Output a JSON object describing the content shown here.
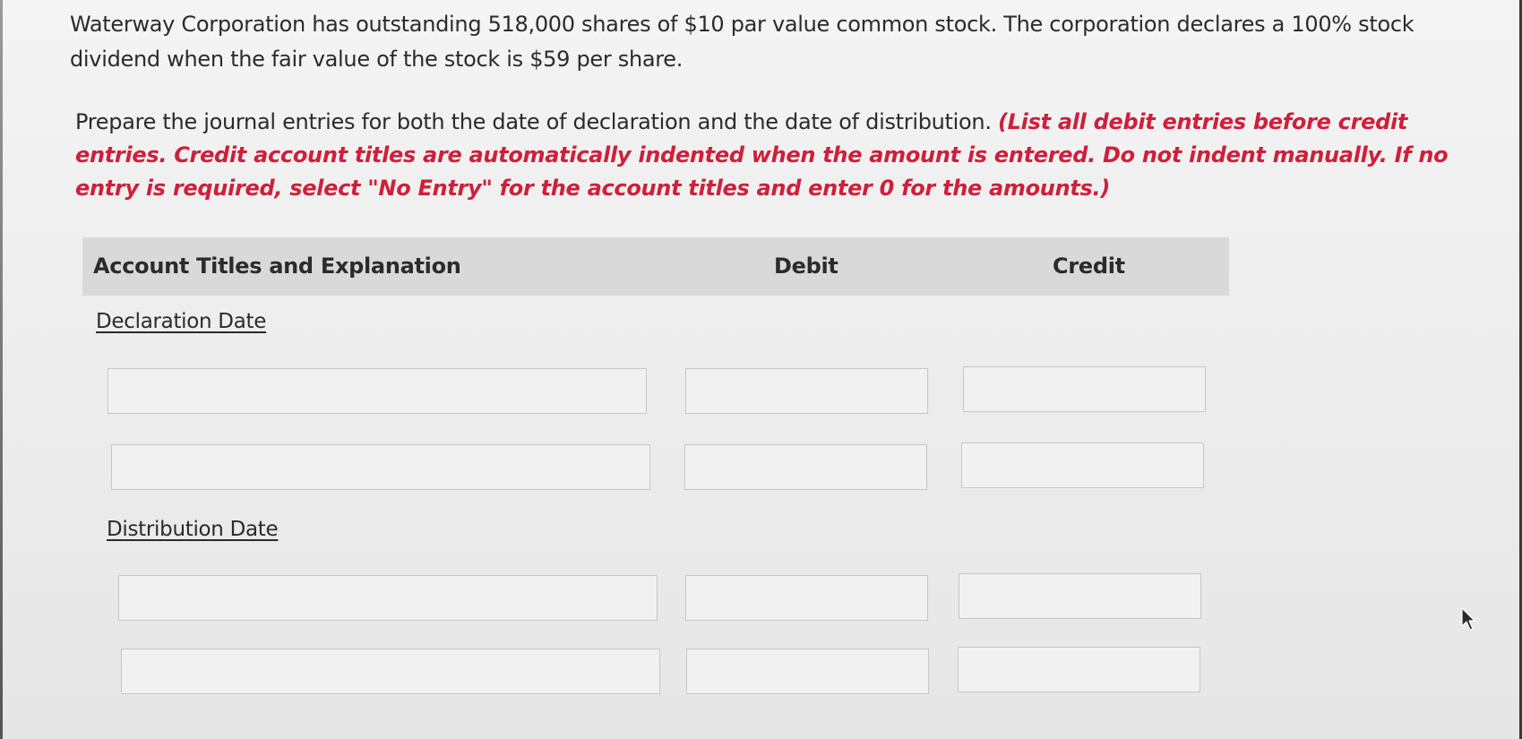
{
  "question": {
    "problem_text": "Waterway Corporation has outstanding 518,000 shares of $10 par value common stock. The corporation declares a 100% stock dividend when the fair value of the stock is $59 per share.",
    "instruction_text": "Prepare the journal entries for both the date of declaration and the date of distribution.",
    "instruction_note": "(List all debit entries before credit entries. Credit account titles are automatically indented when the amount is entered. Do not indent manually. If no entry is required, select \"No Entry\" for the account titles and enter 0 for the amounts.)"
  },
  "table": {
    "headers": {
      "account": "Account Titles and Explanation",
      "debit": "Debit",
      "credit": "Credit"
    },
    "sections": [
      {
        "label": "Declaration Date",
        "rows": [
          {
            "account": "",
            "debit": "",
            "credit": ""
          },
          {
            "account": "",
            "debit": "",
            "credit": ""
          }
        ]
      },
      {
        "label": "Distribution Date",
        "rows": [
          {
            "account": "",
            "debit": "",
            "credit": ""
          },
          {
            "account": "",
            "debit": "",
            "credit": ""
          }
        ]
      }
    ]
  },
  "icons": {
    "cursor": "mouse-pointer-icon"
  },
  "colors": {
    "instruction_red": "#cf1f3a",
    "header_bg": "#d9d9d9",
    "field_border": "#c6c6c6"
  }
}
